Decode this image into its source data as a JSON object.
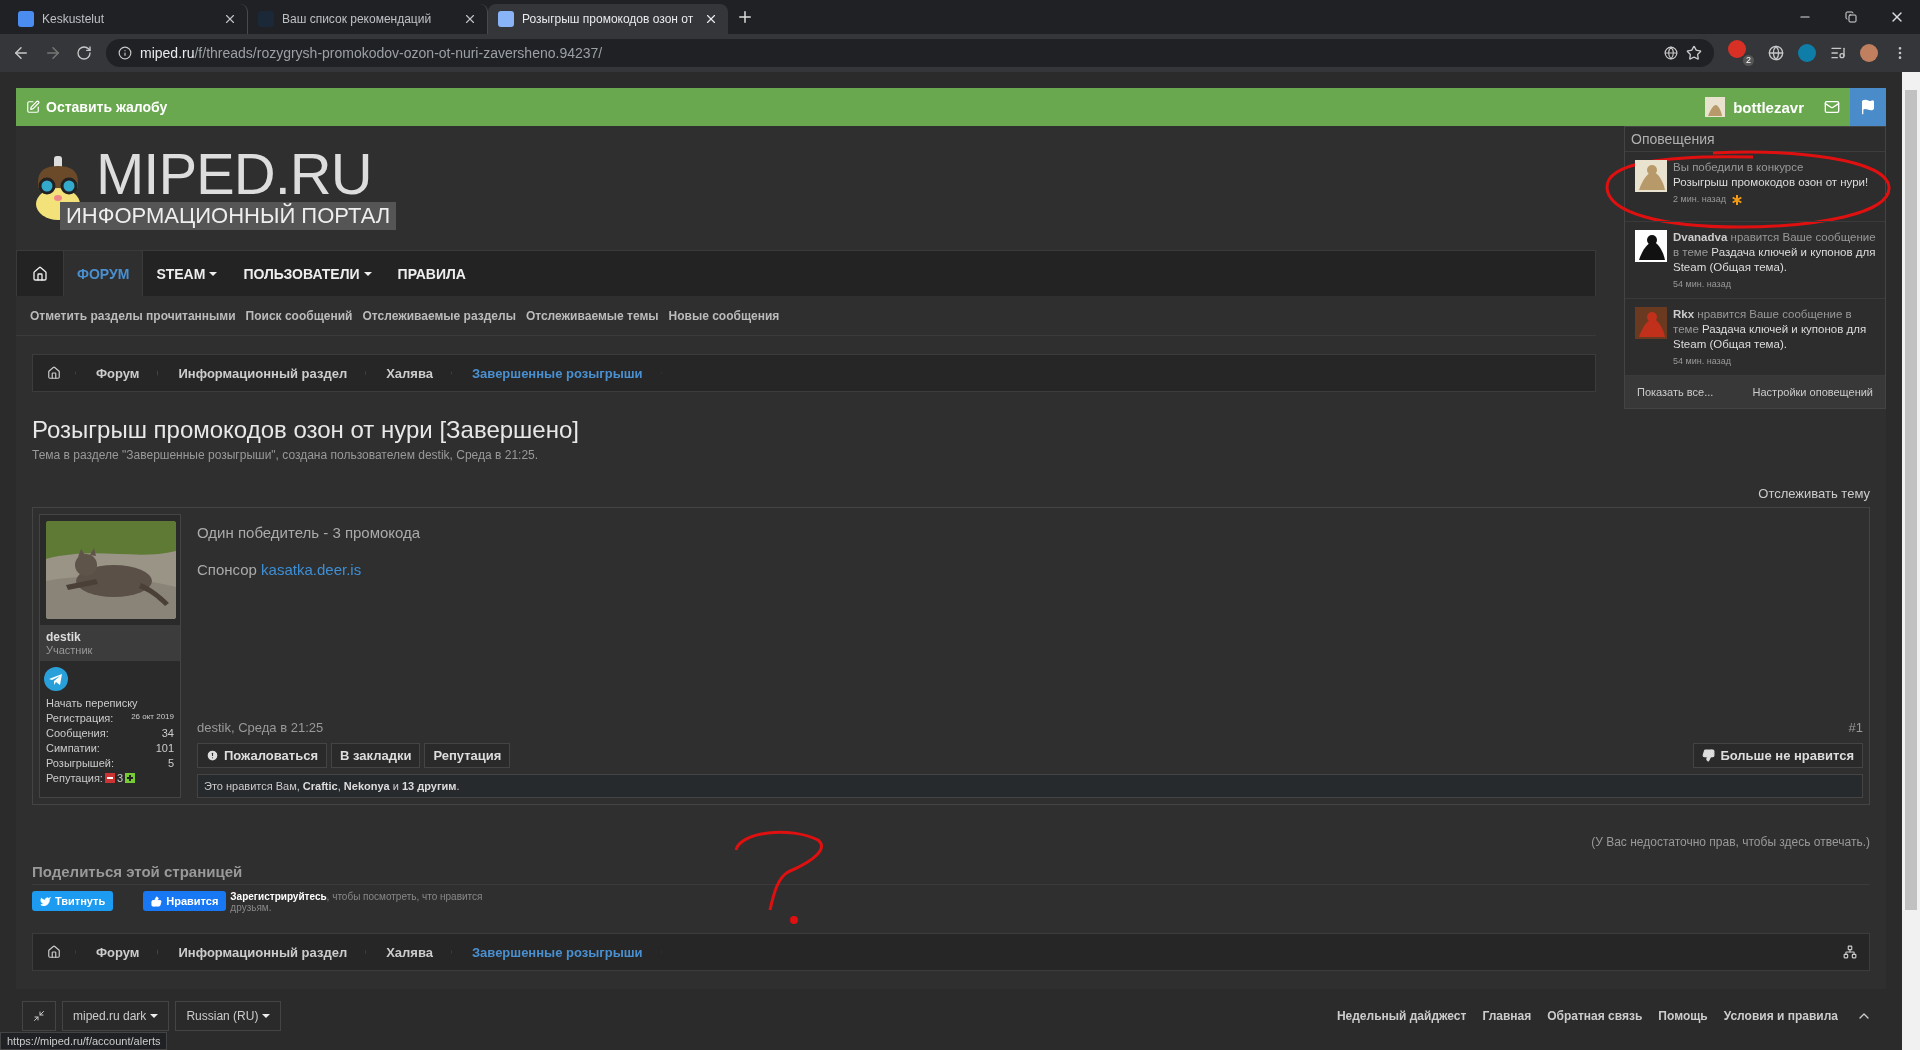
{
  "browser": {
    "tabs": [
      {
        "title": "Keskustelut",
        "selected": false
      },
      {
        "title": "Ваш список рекомендаций",
        "selected": false
      },
      {
        "title": "Розыгрыш промокодов озон от",
        "selected": true
      }
    ],
    "address": {
      "host": "miped.ru",
      "path": "/f/threads/rozygrysh-promokodov-ozon-ot-nuri-zaversheno.94237/"
    },
    "extension_badge": "2",
    "status_url": "https://miped.ru/f/account/alerts"
  },
  "top_bar": {
    "report_label": "Оставить жалобу",
    "username": "bottlezavr",
    "alerts_open": true
  },
  "logo": {
    "title": "MIPED.RU",
    "subtitle": "ИНФОРМАЦИОННЫЙ ПОРТАЛ"
  },
  "nav": {
    "tabs": [
      {
        "label": "ФОРУМ",
        "selected": true,
        "has_menu": false
      },
      {
        "label": "STEAM",
        "selected": false,
        "has_menu": true
      },
      {
        "label": "ПОЛЬЗОВАТЕЛИ",
        "selected": false,
        "has_menu": true
      },
      {
        "label": "ПРАВИЛА",
        "selected": false,
        "has_menu": false
      }
    ],
    "sub_links": [
      "Отметить разделы прочитанными",
      "Поиск сообщений",
      "Отслеживаемые разделы",
      "Отслеживаемые темы",
      "Новые сообщения"
    ]
  },
  "breadcrumbs": [
    {
      "label": "Форум",
      "selected": false
    },
    {
      "label": "Информационный раздел",
      "selected": false
    },
    {
      "label": "Халява",
      "selected": false
    },
    {
      "label": "Завершенные розыгрыши",
      "selected": true
    }
  ],
  "bottom_breadcrumbs": [
    {
      "label": "Форум",
      "selected": false
    },
    {
      "label": "Информационный раздел",
      "selected": false
    },
    {
      "label": "Халява",
      "selected": false
    },
    {
      "label": "Завершенные розыгрыши",
      "selected": true
    }
  ],
  "thread": {
    "title": "Розыгрыш промокодов озон от нури [Завершено]",
    "meta": "Тема в разделе \"Завершенные розыгрыши\", создана пользователем destik, Среда в 21:25.",
    "watch_label": "Отслеживать тему"
  },
  "post": {
    "author": "destik",
    "role": "Участник",
    "start_conversation": "Начать переписку",
    "stats": [
      {
        "label": "Регистрация:",
        "value": "26 окт 2019",
        "kind": "small"
      },
      {
        "label": "Сообщения:",
        "value": "34",
        "kind": "normal"
      },
      {
        "label": "Симпатии:",
        "value": "101",
        "kind": "normal"
      },
      {
        "label": "Розыгрышей:",
        "value": "5",
        "kind": "normal"
      }
    ],
    "reputation": {
      "label": "Репутация:",
      "value": "3"
    },
    "message": {
      "line_1": "Один победитель - 3 промокода",
      "sponsor_label": "Спонсор",
      "sponsor_link": "kasatka.deer.is"
    },
    "date_line": "destik, Среда в 21:25",
    "number": "#1",
    "actions": [
      "Пожаловаться",
      "В закладки",
      "Репутация"
    ],
    "unlike_label": "Больше не нравится",
    "likes": "Это нравится Вам, **Craftic**, **Nekonya** и **13 другим**."
  },
  "reply_notice": "(У Вас недостаточно прав, чтобы здесь отвечать.)",
  "share": {
    "title": "Поделиться этой страницей",
    "tweet_label": "Твитнуть",
    "like_label": "Нравится",
    "like_note": "**Зарегистрируйтесь**, чтобы посмотреть, что нравится друзьям."
  },
  "footer": {
    "style_label": "miped.ru dark",
    "language_label": "Russian (RU)",
    "links": [
      "Недельный дайджест",
      "Главная",
      "Обратная связь",
      "Помощь",
      "Условия и правила"
    ]
  },
  "alerts": {
    "title": "Оповещения",
    "items": [
      {
        "action": "Вы победили в конкурсе",
        "subject": "Розыгрыш промокодов озон от нури!",
        "time": "2 мин. назад",
        "unread": true
      },
      {
        "actor": "Dvanadva",
        "action": "нравится Ваше сообщение в теме",
        "subject": "Раздача ключей и купонов для Steam (Общая тема).",
        "time": "54 мин. назад",
        "unread": false
      },
      {
        "actor": "Rkx",
        "action": "нравится Ваше сообщение в теме",
        "subject": "Раздача ключей и купонов для Steam (Общая тема).",
        "time": "54 мин. назад",
        "unread": false
      }
    ],
    "footer_links": [
      "Показать все...",
      "Настройки оповещений"
    ]
  }
}
